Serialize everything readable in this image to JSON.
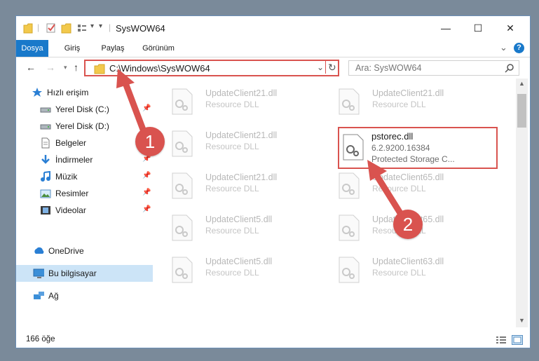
{
  "window": {
    "title": "SysWOW64",
    "minimize_symbol": "—",
    "maximize_symbol": "☐",
    "close_symbol": "✕"
  },
  "ribbon": {
    "tabs": [
      "Dosya",
      "Giriş",
      "Paylaş",
      "Görünüm"
    ],
    "active_tab": "Dosya",
    "expand_symbol": "⌄",
    "help_symbol": "?"
  },
  "nav": {
    "address": "C:\\Windows\\SysWOW64",
    "search_placeholder": "Ara: SysWOW64"
  },
  "sidebar": {
    "items": [
      {
        "label": "Hızlı erişim",
        "icon": "star-icon",
        "pinned": false
      },
      {
        "label": "Yerel Disk (C:)",
        "icon": "drive-icon",
        "pinned": true
      },
      {
        "label": "Yerel Disk (D:)",
        "icon": "drive-icon",
        "pinned": false
      },
      {
        "label": "Belgeler",
        "icon": "document-icon",
        "pinned": true
      },
      {
        "label": "İndirmeler",
        "icon": "download-icon",
        "pinned": true
      },
      {
        "label": "Müzik",
        "icon": "music-icon",
        "pinned": true
      },
      {
        "label": "Resimler",
        "icon": "pictures-icon",
        "pinned": true
      },
      {
        "label": "Videolar",
        "icon": "video-icon",
        "pinned": true
      },
      {
        "label": "OneDrive",
        "icon": "cloud-icon",
        "pinned": false
      },
      {
        "label": "Bu bilgisayar",
        "icon": "computer-icon",
        "pinned": false,
        "selected": true
      },
      {
        "label": "Ağ",
        "icon": "network-icon",
        "pinned": false
      }
    ]
  },
  "files": {
    "left_column": [
      {
        "name": "UpdateClient21.dll",
        "desc": "Resource DLL"
      },
      {
        "name": "UpdateClient21.dll",
        "desc": "Resource DLL"
      },
      {
        "name": "UpdateClient21.dll",
        "desc": "Resource DLL"
      },
      {
        "name": "UpdateClient5.dll",
        "desc": "Resource DLL"
      },
      {
        "name": "UpdateClient5.dll",
        "desc": "Resource DLL"
      }
    ],
    "right_column": [
      {
        "name": "UpdateClient21.dll",
        "desc": "Resource DLL"
      },
      {
        "name": "UpdateClient65.dll",
        "desc": "Resource DLL"
      },
      {
        "name": "UpdateClient65.dll",
        "desc": "Resource DLL"
      },
      {
        "name": "UpdateClient63.dll",
        "desc": "Resource DLL"
      }
    ],
    "target": {
      "name": "pstorec.dll",
      "version": "6.2.9200.16384",
      "description": "Protected Storage C..."
    }
  },
  "status": {
    "count": "166 öğe"
  },
  "annotations": {
    "step1": "1",
    "step2": "2",
    "highlight_color": "#d9534f"
  }
}
